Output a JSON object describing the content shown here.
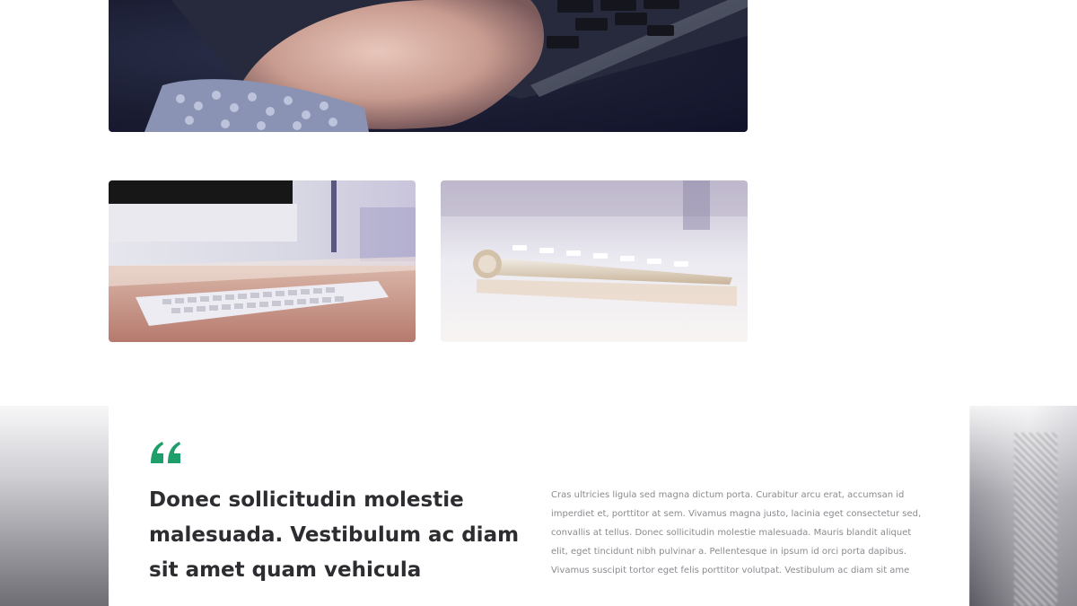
{
  "images": {
    "hero": {
      "icon": "hand-typing-laptop-photo"
    },
    "left": {
      "icon": "keyboard-on-desk-photo"
    },
    "right": {
      "icon": "keyboard-side-view-photo"
    }
  },
  "testimonial": {
    "quote_icon": "quote-marks-icon",
    "quote_color": "#1e9e6a",
    "title": "Donec sollicitudin molestie malesuada. Vestibulum ac diam sit amet quam vehicula",
    "body": "Cras ultricies ligula sed magna dictum porta. Curabitur arcu erat, accumsan id imperdiet et, porttitor at sem. Vivamus magna justo, lacinia eget consectetur sed, convallis at tellus. Donec sollicitudin molestie malesuada. Mauris blandit aliquet elit, eget tincidunt nibh pulvinar a. Pellentesque in ipsum id orci porta dapibus. Vivamus suscipit tortor eget felis porttitor volutpat. Vestibulum ac diam sit ame"
  }
}
